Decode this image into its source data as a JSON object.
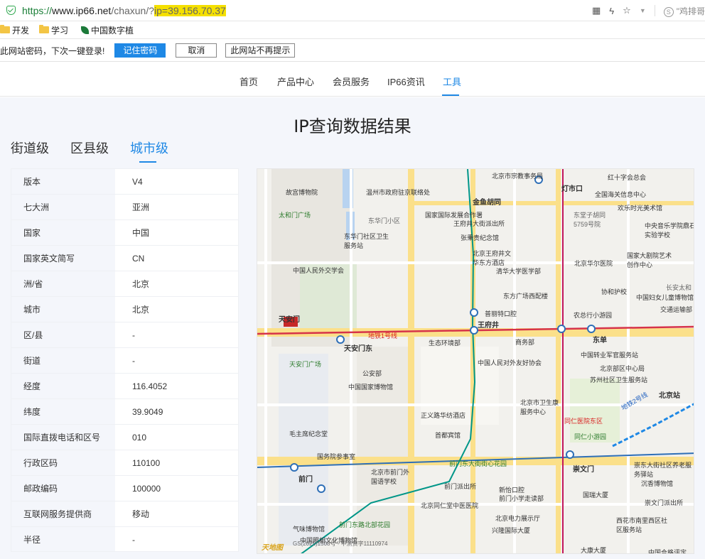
{
  "browser": {
    "url_proto": "https://",
    "url_host": "www.ip66.net",
    "url_path": "/chaxun/?",
    "url_query": "ip=39.156.70.37",
    "right_search": "\"鸡排哥"
  },
  "bookmarks": [
    {
      "label": "开发"
    },
    {
      "label": "学习"
    },
    {
      "label": "中国数字植"
    }
  ],
  "password_bar": {
    "message": "此网站密码，下次一键登录!",
    "save_label": "记住密码",
    "cancel_label": "取消",
    "never_label": "此网站不再提示"
  },
  "nav": {
    "items": [
      "首页",
      "产品中心",
      "会员服务",
      "IP66资讯",
      "工具"
    ],
    "active": "工具"
  },
  "page": {
    "title": "IP查询数据结果",
    "levels": [
      "街道级",
      "区县级",
      "城市级"
    ],
    "active_level": "城市级"
  },
  "info_rows": [
    {
      "key": "版本",
      "value": "V4"
    },
    {
      "key": "七大洲",
      "value": "亚洲"
    },
    {
      "key": "国家",
      "value": "中国"
    },
    {
      "key": "国家英文简写",
      "value": "CN"
    },
    {
      "key": "洲/省",
      "value": "北京"
    },
    {
      "key": "城市",
      "value": "北京"
    },
    {
      "key": "区/县",
      "value": "-"
    },
    {
      "key": "街道",
      "value": "-"
    },
    {
      "key": "经度",
      "value": "116.4052"
    },
    {
      "key": "纬度",
      "value": "39.9049"
    },
    {
      "key": "国际直拨电话和区号",
      "value": "010"
    },
    {
      "key": "行政区码",
      "value": "110100"
    },
    {
      "key": "邮政编码",
      "value": "100000"
    },
    {
      "key": "互联网服务提供商",
      "value": "移动"
    },
    {
      "key": "半径",
      "value": "-"
    }
  ],
  "map": {
    "labels": [
      "北京市宗教事务局",
      "红十字会总会",
      "灯市口",
      "全国海关信息中心",
      "故宫博物院",
      "温州市政府驻京联络处",
      "金鱼胡同",
      "欢乐时光美术馆",
      "太和门广场",
      "国家国际发展合作署",
      "王府井大街派出所",
      "东堂子胡同5759号院",
      "中央音乐学院鼎石实验学校",
      "东华门小区",
      "东华门社区卫生服务站",
      "张秉贵纪念馆",
      "北京王府井文华东方酒店",
      "清华大学医学部",
      "国家大剧院艺术创作中心",
      "北京华尔医院",
      "中国人民外交学会",
      "协和护校",
      "中国妇女儿童博物馆",
      "长安太和",
      "东方广场西配楼",
      "普丽特口腔",
      "王府井",
      "农总行小游园",
      "交通运输部",
      "天安门",
      "地铁1号线",
      "生态环境部",
      "商务部",
      "东单",
      "天安门东",
      "中国转业军官服务站",
      "北京部区中心局",
      "苏州社区卫生服务站",
      "天安门广场",
      "中国人民对外友好协会",
      "公安部",
      "中国国家博物馆",
      "北京市卫生康服务中心",
      "北京站",
      "同仁医院东区",
      "地铁2号线",
      "正义路华纺酒店",
      "首都宾馆",
      "毛主席纪念堂",
      "同仁小游园",
      "国务院参事室",
      "前门东大街街心花园",
      "崇文门",
      "崇东大街社区养老服务驿站",
      "前门",
      "北京市前门外国语学校",
      "沉香博物馆",
      "新怡口腔",
      "前门派出所",
      "前门小学走读部",
      "国瑞大厦",
      "崇文门派出所",
      "北京同仁堂中医医院",
      "北京电力展示厅",
      "西花市南里西区社区服务站",
      "兴隆国际大厦",
      "前门东路北部花园",
      "气味博物馆",
      "中国照相文化博物馆",
      "大康大厦",
      "中国合格评定",
      "GS(2025)1508号 - 甲测资字11110974",
      "天地图"
    ]
  }
}
